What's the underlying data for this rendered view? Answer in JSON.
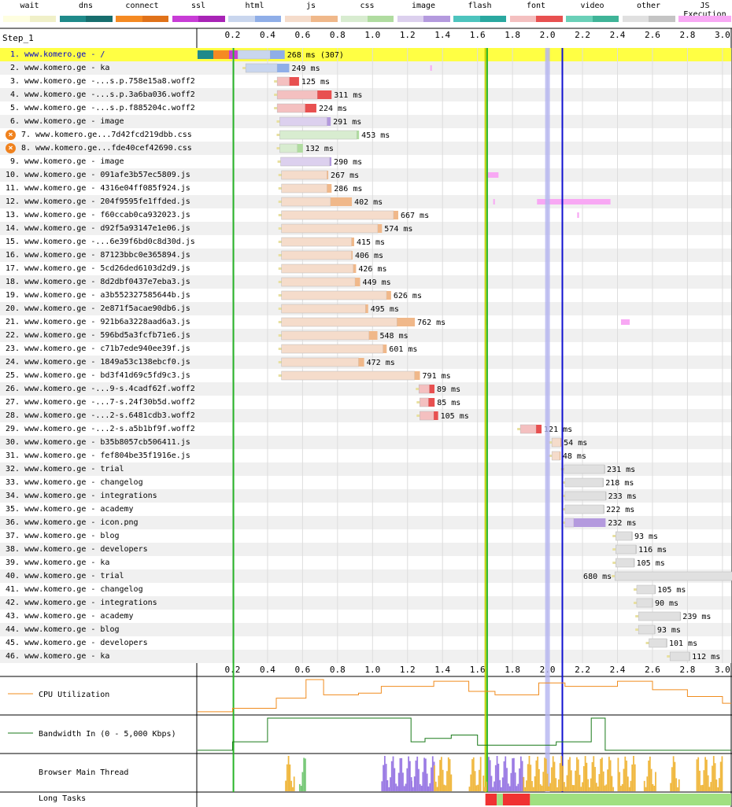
{
  "legend": [
    {
      "label": "wait",
      "c1": "#fefee0",
      "c2": "#f0f0c8"
    },
    {
      "label": "dns",
      "c1": "#1f8a8a",
      "c2": "#176e6e"
    },
    {
      "label": "connect",
      "c1": "#f58a22",
      "c2": "#e0721a"
    },
    {
      "label": "ssl",
      "c1": "#c83cd6",
      "c2": "#a824b6"
    },
    {
      "label": "html",
      "c1": "#c9d6ee",
      "c2": "#8faee8"
    },
    {
      "label": "js",
      "c1": "#f5dccb",
      "c2": "#f0b88a"
    },
    {
      "label": "css",
      "c1": "#d8ecd0",
      "c2": "#b0dca0"
    },
    {
      "label": "image",
      "c1": "#dcd0ee",
      "c2": "#b49ade"
    },
    {
      "label": "flash",
      "c1": "#4dc4be",
      "c2": "#2aa8a0"
    },
    {
      "label": "font",
      "c1": "#f4c0c0",
      "c2": "#e85050"
    },
    {
      "label": "video",
      "c1": "#6ad0b8",
      "c2": "#3fb498"
    },
    {
      "label": "other",
      "c1": "#e0e0e0",
      "c2": "#c4c4c4"
    },
    {
      "label": "JS Execution",
      "c1": "#f8a8f4",
      "c2": "#f8a8f4"
    }
  ],
  "chart_data": {
    "type": "waterfall",
    "title": "Step_1",
    "x_unit": "seconds",
    "xlim": [
      0,
      3.05
    ],
    "ticks": [
      "0.2",
      "0.4",
      "0.6",
      "0.8",
      "1.0",
      "1.2",
      "1.4",
      "1.6",
      "1.8",
      "2.0",
      "2.2",
      "2.4",
      "2.6",
      "2.8",
      "3.0"
    ],
    "markers": [
      {
        "name": "start-render",
        "time": 0.205,
        "color": "#28b428"
      },
      {
        "name": "dom-content-loaded",
        "time": 1.645,
        "color": "#c0d000"
      },
      {
        "name": "on-load",
        "time": 1.655,
        "color": "#28b428"
      },
      {
        "name": "dom-interactive",
        "time": 2.0,
        "color": "#b4b4f0"
      },
      {
        "name": "document-complete",
        "time": 2.085,
        "color": "#1010d0"
      }
    ],
    "requests": [
      {
        "label": "1. www.komero.ge - /",
        "start": 0.0,
        "dns": 0.09,
        "connect": 0.09,
        "ssl": 0.05,
        "wait": 0.02,
        "ttfb": 0.185,
        "download": 0.083,
        "type": "html",
        "duration": "268 ms (307)",
        "highlight": true
      },
      {
        "label": "2. www.komero.ge - ka",
        "start": 0.275,
        "ttfb": 0.18,
        "download": 0.069,
        "type": "html",
        "duration": "249 ms"
      },
      {
        "label": "3. www.komero.ge -...s.p.758e15a8.woff2",
        "start": 0.455,
        "ttfb": 0.07,
        "download": 0.055,
        "type": "font",
        "duration": "125 ms"
      },
      {
        "label": "4. www.komero.ge -...s.p.3a6ba036.woff2",
        "start": 0.455,
        "ttfb": 0.23,
        "download": 0.081,
        "type": "font",
        "duration": "311 ms"
      },
      {
        "label": "5. www.komero.ge -...s.p.f885204c.woff2",
        "start": 0.455,
        "ttfb": 0.16,
        "download": 0.064,
        "type": "font",
        "duration": "224 ms"
      },
      {
        "label": "6. www.komero.ge - image",
        "start": 0.47,
        "ttfb": 0.27,
        "download": 0.021,
        "type": "image",
        "duration": "291 ms"
      },
      {
        "label": "7. www.komero.ge...7d42fcd219dbb.css",
        "start": 0.47,
        "ttfb": 0.44,
        "download": 0.013,
        "type": "css",
        "duration": "453 ms",
        "warn": true
      },
      {
        "label": "8. www.komero.ge...fde40cef42690.css",
        "start": 0.47,
        "ttfb": 0.1,
        "download": 0.032,
        "type": "css",
        "duration": "132 ms",
        "warn": true
      },
      {
        "label": "9. www.komero.ge - image",
        "start": 0.475,
        "ttfb": 0.28,
        "download": 0.01,
        "type": "image",
        "duration": "290 ms"
      },
      {
        "label": "10. www.komero.ge - 091afe3b57ec5809.js",
        "start": 0.48,
        "ttfb": 0.26,
        "download": 0.007,
        "type": "js",
        "duration": "267 ms"
      },
      {
        "label": "11. www.komero.ge - 4316e04ff085f924.js",
        "start": 0.48,
        "ttfb": 0.26,
        "download": 0.026,
        "type": "js",
        "duration": "286 ms"
      },
      {
        "label": "12. www.komero.ge - 204f9595fe1ffded.js",
        "start": 0.48,
        "ttfb": 0.28,
        "download": 0.122,
        "type": "js",
        "duration": "402 ms"
      },
      {
        "label": "13. www.komero.ge - f60ccab0ca932023.js",
        "start": 0.48,
        "ttfb": 0.64,
        "download": 0.027,
        "type": "js",
        "duration": "667 ms"
      },
      {
        "label": "14. www.komero.ge - d92f5a93147e1e06.js",
        "start": 0.48,
        "ttfb": 0.55,
        "download": 0.024,
        "type": "js",
        "duration": "574 ms"
      },
      {
        "label": "15. www.komero.ge -...6e39f6bd0c8d30d.js",
        "start": 0.48,
        "ttfb": 0.4,
        "download": 0.015,
        "type": "js",
        "duration": "415 ms"
      },
      {
        "label": "16. www.komero.ge - 87123bbc0e365894.js",
        "start": 0.48,
        "ttfb": 0.4,
        "download": 0.006,
        "type": "js",
        "duration": "406 ms"
      },
      {
        "label": "17. www.komero.ge - 5cd26ded6103d2d9.js",
        "start": 0.48,
        "ttfb": 0.41,
        "download": 0.016,
        "type": "js",
        "duration": "426 ms"
      },
      {
        "label": "18. www.komero.ge - 8d2dbf0437e7eba3.js",
        "start": 0.48,
        "ttfb": 0.42,
        "download": 0.029,
        "type": "js",
        "duration": "449 ms"
      },
      {
        "label": "19. www.komero.ge - a3b552327585644b.js",
        "start": 0.48,
        "ttfb": 0.6,
        "download": 0.026,
        "type": "js",
        "duration": "626 ms"
      },
      {
        "label": "20. www.komero.ge - 2e871f5acae90db6.js",
        "start": 0.48,
        "ttfb": 0.48,
        "download": 0.015,
        "type": "js",
        "duration": "495 ms"
      },
      {
        "label": "21. www.komero.ge - 921b6a3228aad6a3.js",
        "start": 0.48,
        "ttfb": 0.66,
        "download": 0.102,
        "type": "js",
        "duration": "762 ms"
      },
      {
        "label": "22. www.komero.ge - 596bd5a3fcfb71e6.js",
        "start": 0.48,
        "ttfb": 0.5,
        "download": 0.048,
        "type": "js",
        "duration": "548 ms"
      },
      {
        "label": "23. www.komero.ge - c71b7ede940ee39f.js",
        "start": 0.48,
        "ttfb": 0.58,
        "download": 0.021,
        "type": "js",
        "duration": "601 ms"
      },
      {
        "label": "24. www.komero.ge - 1849a53c138ebcf0.js",
        "start": 0.48,
        "ttfb": 0.44,
        "download": 0.032,
        "type": "js",
        "duration": "472 ms"
      },
      {
        "label": "25. www.komero.ge - bd3f41d69c5fd9c3.js",
        "start": 0.48,
        "ttfb": 0.76,
        "download": 0.031,
        "type": "js",
        "duration": "791 ms"
      },
      {
        "label": "26. www.komero.ge -...9-s.4cadf62f.woff2",
        "start": 1.265,
        "ttfb": 0.06,
        "download": 0.029,
        "type": "font",
        "duration": "89 ms"
      },
      {
        "label": "27. www.komero.ge -...7-s.24f30b5d.woff2",
        "start": 1.27,
        "ttfb": 0.05,
        "download": 0.035,
        "type": "font",
        "duration": "85 ms"
      },
      {
        "label": "28. www.komero.ge -...2-s.6481cdb3.woff2",
        "start": 1.27,
        "ttfb": 0.08,
        "download": 0.025,
        "type": "font",
        "duration": "105 ms"
      },
      {
        "label": "29. www.komero.ge -...2-s.a5b1bf9f.woff2",
        "start": 1.845,
        "ttfb": 0.09,
        "download": 0.031,
        "type": "font",
        "duration": "121 ms"
      },
      {
        "label": "30. www.komero.ge - b35b8057cb506411.js",
        "start": 2.025,
        "ttfb": 0.05,
        "download": 0.004,
        "type": "js",
        "duration": "54 ms"
      },
      {
        "label": "31. www.komero.ge - fef804be35f1916e.js",
        "start": 2.025,
        "ttfb": 0.045,
        "download": 0.003,
        "type": "js",
        "duration": "48 ms"
      },
      {
        "label": "32. www.komero.ge - trial",
        "start": 2.095,
        "ttfb": 0.23,
        "download": 0.001,
        "type": "other",
        "duration": "231 ms"
      },
      {
        "label": "33. www.komero.ge - changelog",
        "start": 2.1,
        "ttfb": 0.217,
        "download": 0.001,
        "type": "other",
        "duration": "218 ms"
      },
      {
        "label": "34. www.komero.ge - integrations",
        "start": 2.1,
        "ttfb": 0.232,
        "download": 0.001,
        "type": "other",
        "duration": "233 ms"
      },
      {
        "label": "35. www.komero.ge - academy",
        "start": 2.1,
        "ttfb": 0.221,
        "download": 0.001,
        "type": "other",
        "duration": "222 ms"
      },
      {
        "label": "36. www.komero.ge - icon.png",
        "start": 2.1,
        "ttfb": 0.05,
        "download": 0.182,
        "type": "image",
        "duration": "232 ms"
      },
      {
        "label": "37. www.komero.ge - blog",
        "start": 2.39,
        "ttfb": 0.092,
        "download": 0.001,
        "type": "other",
        "duration": "93 ms"
      },
      {
        "label": "38. www.komero.ge - developers",
        "start": 2.39,
        "ttfb": 0.115,
        "download": 0.001,
        "type": "other",
        "duration": "116 ms"
      },
      {
        "label": "39. www.komero.ge - ka",
        "start": 2.39,
        "ttfb": 0.104,
        "download": 0.001,
        "type": "other",
        "duration": "105 ms"
      },
      {
        "label": "40. www.komero.ge - trial",
        "start": 2.385,
        "ttfb": 0.679,
        "download": 0.001,
        "type": "other",
        "duration": "680 ms",
        "label_left": true
      },
      {
        "label": "41. www.komero.ge - changelog",
        "start": 2.51,
        "ttfb": 0.104,
        "download": 0.001,
        "type": "other",
        "duration": "105 ms"
      },
      {
        "label": "42. www.komero.ge - integrations",
        "start": 2.51,
        "ttfb": 0.089,
        "download": 0.001,
        "type": "other",
        "duration": "90 ms"
      },
      {
        "label": "43. www.komero.ge - academy",
        "start": 2.52,
        "ttfb": 0.238,
        "download": 0.001,
        "type": "other",
        "duration": "239 ms"
      },
      {
        "label": "44. www.komero.ge - blog",
        "start": 2.52,
        "ttfb": 0.092,
        "download": 0.001,
        "type": "other",
        "duration": "93 ms"
      },
      {
        "label": "45. www.komero.ge - developers",
        "start": 2.58,
        "ttfb": 0.1,
        "download": 0.001,
        "type": "other",
        "duration": "101 ms"
      },
      {
        "label": "46. www.komero.ge - ka",
        "start": 2.7,
        "ttfb": 0.111,
        "download": 0.001,
        "type": "other",
        "duration": "112 ms"
      }
    ],
    "js_execution": [
      {
        "row": 2,
        "start": 1.33,
        "end": 1.335
      },
      {
        "row": 10,
        "start": 1.65,
        "end": 1.72
      },
      {
        "row": 12,
        "start": 1.69,
        "end": 1.695
      },
      {
        "row": 12,
        "start": 1.94,
        "end": 2.36
      },
      {
        "row": 13,
        "start": 2.17,
        "end": 2.18
      },
      {
        "row": 21,
        "start": 1.65,
        "end": 1.655
      },
      {
        "row": 21,
        "start": 2.42,
        "end": 2.47
      }
    ],
    "cpu_utilization": {
      "label": "CPU Utilization",
      "color": "#f08c1e",
      "points": [
        [
          0.0,
          0.05
        ],
        [
          0.2,
          0.05
        ],
        [
          0.2,
          0.15
        ],
        [
          0.45,
          0.15
        ],
        [
          0.45,
          0.45
        ],
        [
          0.62,
          0.45
        ],
        [
          0.62,
          1.0
        ],
        [
          0.72,
          1.0
        ],
        [
          0.72,
          0.55
        ],
        [
          0.92,
          0.55
        ],
        [
          0.92,
          0.6
        ],
        [
          1.05,
          0.6
        ],
        [
          1.05,
          0.8
        ],
        [
          1.35,
          0.8
        ],
        [
          1.35,
          0.95
        ],
        [
          1.55,
          0.95
        ],
        [
          1.55,
          0.65
        ],
        [
          1.7,
          0.65
        ],
        [
          1.7,
          0.55
        ],
        [
          1.95,
          0.55
        ],
        [
          1.95,
          0.9
        ],
        [
          2.1,
          0.9
        ],
        [
          2.1,
          0.8
        ],
        [
          2.4,
          0.8
        ],
        [
          2.4,
          0.95
        ],
        [
          2.6,
          0.95
        ],
        [
          2.6,
          0.7
        ],
        [
          2.8,
          0.7
        ],
        [
          2.8,
          0.5
        ],
        [
          3.0,
          0.5
        ],
        [
          3.0,
          0.3
        ],
        [
          3.05,
          0.3
        ]
      ]
    },
    "bandwidth_in": {
      "label": "Bandwidth In (0 - 5,000 Kbps)",
      "color": "#1a7a1a",
      "points": [
        [
          0.0,
          0.05
        ],
        [
          0.2,
          0.05
        ],
        [
          0.2,
          0.3
        ],
        [
          0.4,
          0.3
        ],
        [
          0.4,
          1.0
        ],
        [
          1.22,
          1.0
        ],
        [
          1.22,
          0.3
        ],
        [
          1.3,
          0.3
        ],
        [
          1.3,
          0.4
        ],
        [
          1.45,
          0.4
        ],
        [
          1.45,
          0.5
        ],
        [
          1.6,
          0.5
        ],
        [
          1.6,
          0.2
        ],
        [
          2.05,
          0.2
        ],
        [
          2.05,
          0.3
        ],
        [
          2.25,
          0.3
        ],
        [
          2.25,
          1.0
        ],
        [
          2.33,
          1.0
        ],
        [
          2.33,
          0.05
        ],
        [
          3.05,
          0.05
        ]
      ]
    },
    "main_thread_label": "Browser Main Thread",
    "long_tasks_label": "Long Tasks",
    "long_tasks": [
      {
        "start": 1.645,
        "end": 1.71,
        "color": "#f03232"
      },
      {
        "start": 1.71,
        "end": 1.745,
        "color": "#a0e080"
      },
      {
        "start": 1.745,
        "end": 1.9,
        "color": "#f03232"
      },
      {
        "start": 1.9,
        "end": 3.05,
        "color": "#a0e080"
      }
    ],
    "main_thread_colors": {
      "script": "#f0b840",
      "layout": "#9a7ae4",
      "paint": "#78c878",
      "other": "#8080f0"
    }
  }
}
